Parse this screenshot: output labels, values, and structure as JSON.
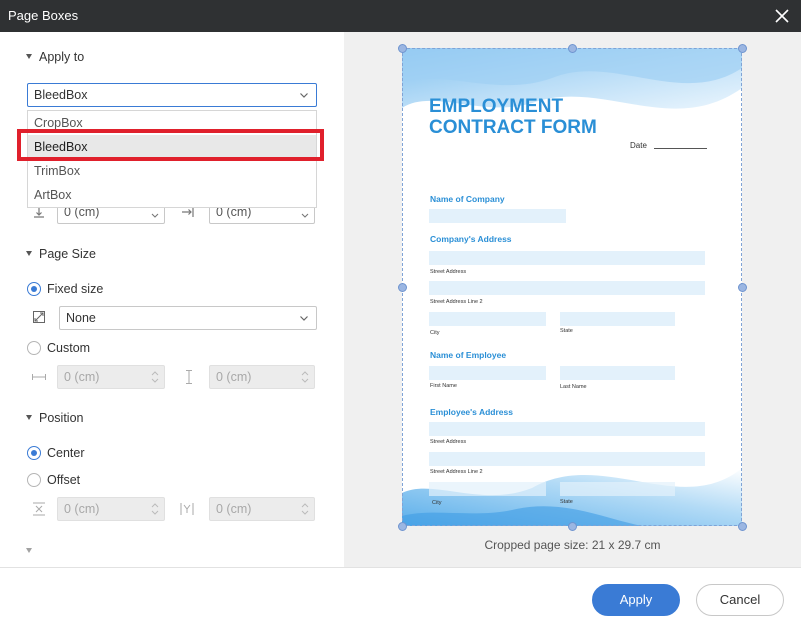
{
  "window": {
    "title": "Page Boxes"
  },
  "apply_to": {
    "heading": "Apply to",
    "selected": "BleedBox",
    "options": [
      "CropBox",
      "BleedBox",
      "TrimBox",
      "ArtBox"
    ]
  },
  "margins": {
    "left_value": "0 (cm)",
    "right_value": "0 (cm)"
  },
  "page_size": {
    "heading": "Page Size",
    "fixed_label": "Fixed size",
    "fixed_select": "None",
    "custom_label": "Custom",
    "width_value": "0 (cm)",
    "height_value": "0 (cm)"
  },
  "position": {
    "heading": "Position",
    "center_label": "Center",
    "offset_label": "Offset",
    "x_value": "0 (cm)",
    "y_value": "0 (cm)"
  },
  "preview": {
    "caption": "Cropped page size: 21 x 29.7 cm",
    "doc": {
      "title_line1": "EMPLOYMENT",
      "title_line2": "CONTRACT FORM",
      "date_label": "Date",
      "name_of_company": "Name of Company",
      "company_address": "Company's Address",
      "street_address": "Street Address",
      "street_address_line2": "Street Address Line 2",
      "city": "City",
      "state": "State",
      "name_of_employee": "Name of Employee",
      "first_name": "First Name",
      "last_name": "Last Name",
      "employee_address": "Employee's Address"
    }
  },
  "footer": {
    "apply_label": "Apply",
    "cancel_label": "Cancel"
  },
  "colors": {
    "accent": "#3a7bd5",
    "highlight": "#e0202c",
    "titlebar": "#2f3133",
    "doc_blue": "#2a8fd6"
  }
}
